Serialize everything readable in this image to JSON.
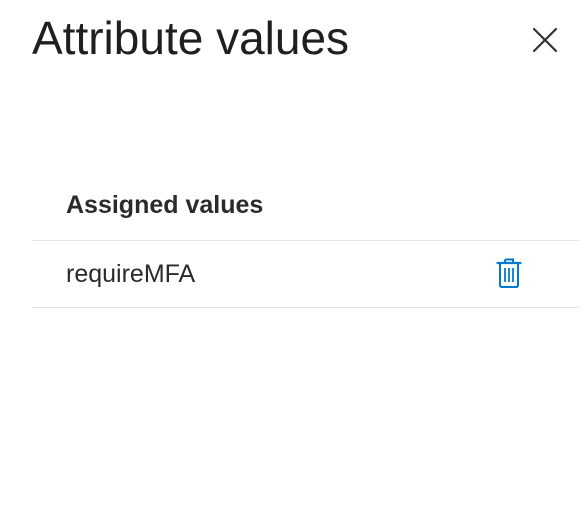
{
  "panel": {
    "title": "Attribute values"
  },
  "table": {
    "header": "Assigned values",
    "rows": [
      {
        "value": "requireMFA"
      }
    ]
  },
  "icons": {
    "close": "close-icon",
    "delete": "trash-icon"
  },
  "colors": {
    "accent": "#0078d4",
    "text": "#1f1f1f",
    "divider": "#e3e3e3"
  }
}
